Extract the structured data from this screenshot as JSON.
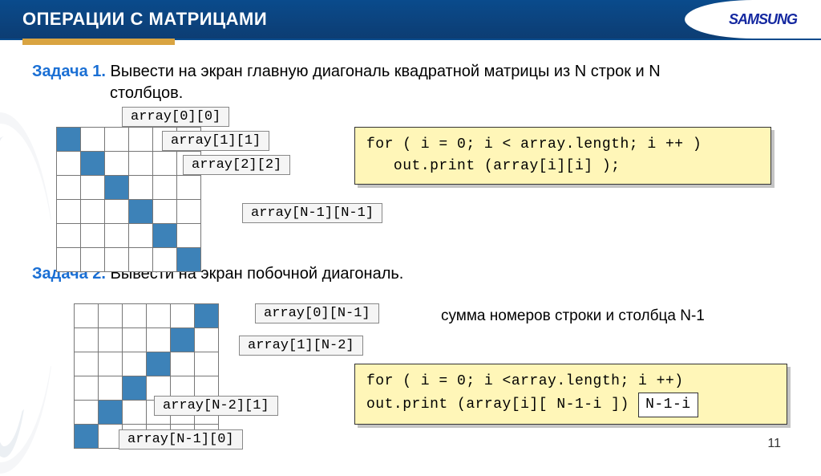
{
  "header": {
    "title": "ОПЕРАЦИИ С МАТРИЦАМИ",
    "logo": "SAMSUNG"
  },
  "task1": {
    "label": "Задача 1.",
    "text": "Вывести на экран главную диагональ квадратной матрицы из N строк и N",
    "text2": "столбцов.",
    "callouts": {
      "a00": "array[0][0]",
      "a11": "array[1][1]",
      "a22": "array[2][2]",
      "aNN": "array[N-1][N-1]"
    },
    "code": {
      "line1": "for ( i = 0;  i < array.length;  i ++ )",
      "line2": "  out.print (array[i][i] );"
    }
  },
  "task2": {
    "label": "Задача 2.",
    "text": "Вывести на экран побочной диагональ.",
    "sumnote": "сумма номеров строки и столбца N-1",
    "callouts": {
      "a0N": "array[0][N-1]",
      "a1N": "array[1][N-2]",
      "aN21": "array[N-2][1]",
      "aN10": "array[N-1][0]"
    },
    "code": {
      "line1": "for ( i = 0;  i <array.length;  i ++)",
      "line2a": "  out.print (array[i][ N-1-i ])",
      "highlight": "N-1-i"
    }
  },
  "page": "11"
}
